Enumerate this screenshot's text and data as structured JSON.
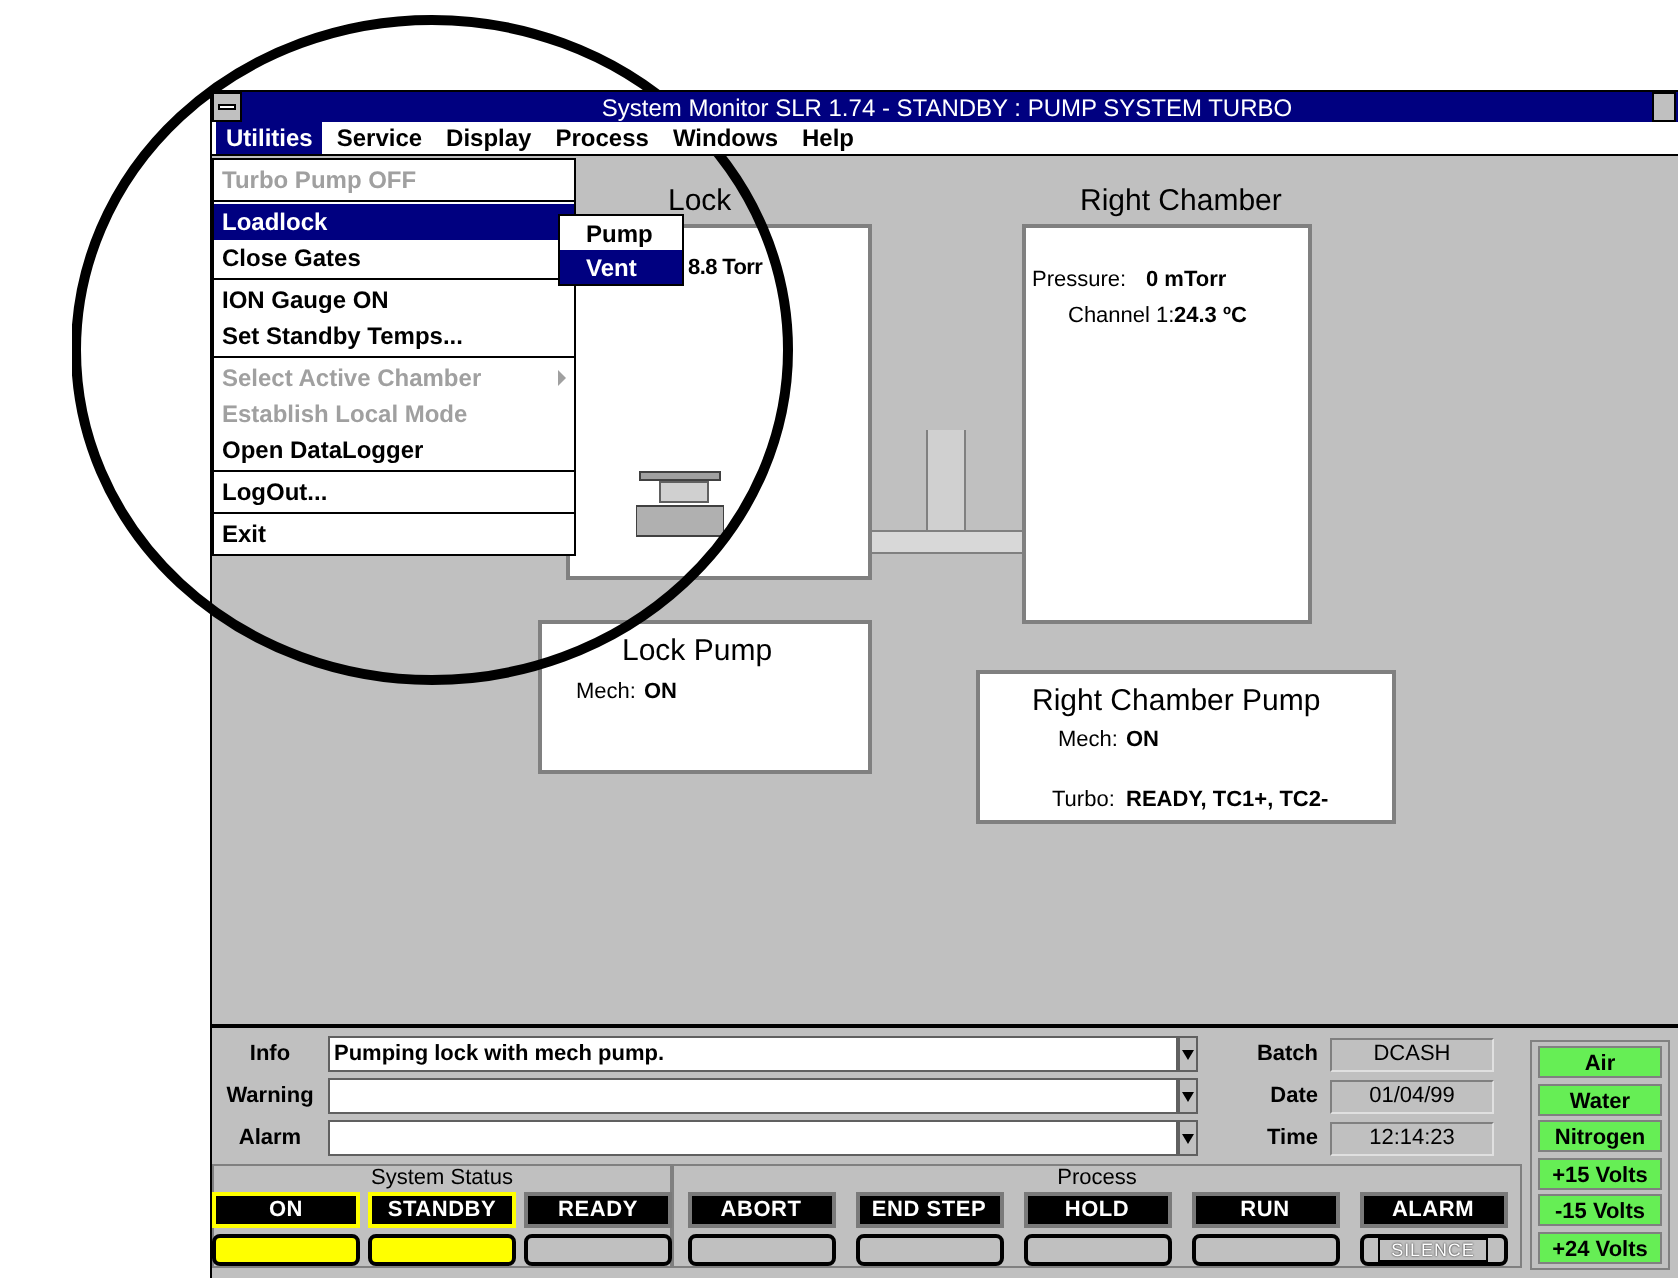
{
  "window": {
    "title": "System Monitor SLR 1.74 - STANDBY : PUMP SYSTEM TURBO"
  },
  "menu_bar": [
    {
      "label": "Utilities",
      "selected": true
    },
    {
      "label": "Service",
      "selected": false
    },
    {
      "label": "Display",
      "selected": false
    },
    {
      "label": "Process",
      "selected": false
    },
    {
      "label": "Windows",
      "selected": false
    },
    {
      "label": "Help",
      "selected": false
    }
  ],
  "menu": {
    "groups": [
      [
        {
          "label": "Turbo Pump OFF",
          "disabled": true,
          "selected": false
        }
      ],
      [
        {
          "label": "Loadlock",
          "disabled": false,
          "selected": true
        },
        {
          "label": "Close Gates",
          "disabled": false,
          "selected": false
        }
      ],
      [
        {
          "label": "ION Gauge ON",
          "disabled": false,
          "selected": false
        },
        {
          "label": "Set Standby Temps...",
          "disabled": false,
          "selected": false
        }
      ],
      [
        {
          "label": "Select Active Chamber",
          "disabled": true,
          "selected": false,
          "submenu": true
        },
        {
          "label": "Establish Local Mode",
          "disabled": true,
          "selected": false
        },
        {
          "label": "Open DataLogger",
          "disabled": false,
          "selected": false
        }
      ],
      [
        {
          "label": "LogOut...",
          "disabled": false,
          "selected": false
        }
      ],
      [
        {
          "label": "Exit",
          "disabled": false,
          "selected": false
        }
      ]
    ],
    "submenu": [
      {
        "label": "Pump",
        "selected": false
      },
      {
        "label": "Vent",
        "selected": true
      }
    ]
  },
  "diagram": {
    "lock": {
      "title": "Lock",
      "reading": "8.8 Torr"
    },
    "right_chamber": {
      "title": "Right Chamber",
      "pressure_label": "Pressure:",
      "pressure": "0 mTorr",
      "channel_label": "Channel 1:",
      "channel": "24.3 ºC"
    },
    "lock_pump": {
      "title": "Lock Pump",
      "mech_label": "Mech:",
      "mech": "ON"
    },
    "right_chamber_pump": {
      "title": "Right Chamber Pump",
      "mech_label": "Mech:",
      "mech": "ON",
      "turbo_label": "Turbo:",
      "turbo": "READY, TC1+, TC2-"
    }
  },
  "messages": [
    {
      "label": "Info",
      "value": "Pumping lock with mech pump."
    },
    {
      "label": "Warning"
    },
    {
      "label": "Alarm"
    }
  ],
  "info": [
    {
      "label": "Batch",
      "value": "DCASH"
    },
    {
      "label": "Date",
      "value": "01/04/99"
    },
    {
      "label": "Time",
      "value": "12:14:23"
    }
  ],
  "system_status": {
    "title": "System Status",
    "buttons": [
      {
        "label": "ON",
        "on": true
      },
      {
        "label": "STANDBY",
        "on": true
      },
      {
        "label": "READY",
        "on": false
      }
    ]
  },
  "process": {
    "title": "Process",
    "buttons": [
      {
        "label": "ABORT",
        "on": false
      },
      {
        "label": "END STEP",
        "on": false
      },
      {
        "label": "HOLD",
        "on": false
      },
      {
        "label": "RUN",
        "on": false
      },
      {
        "label": "ALARM",
        "on": false,
        "lamp_label": "SILENCE"
      }
    ]
  },
  "indicators": [
    {
      "label": "Air",
      "on": true
    },
    {
      "label": "Water",
      "on": true
    },
    {
      "label": "Nitrogen",
      "on": true
    },
    {
      "label": "+15 Volts",
      "on": true
    },
    {
      "label": "-15 Volts",
      "on": true
    },
    {
      "label": "+24 Volts",
      "on": true
    }
  ]
}
